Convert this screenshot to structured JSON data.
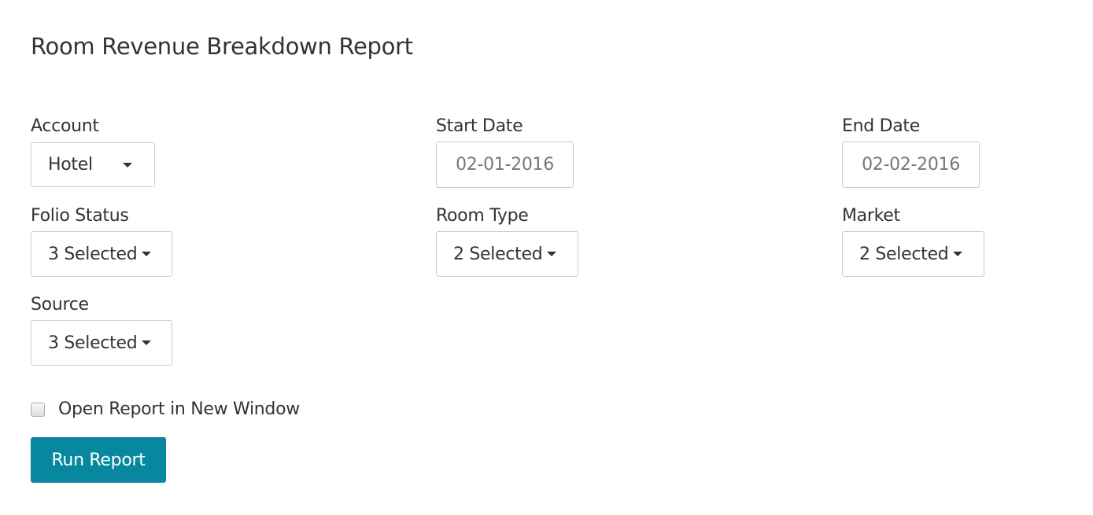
{
  "title": "Room Revenue Breakdown Report",
  "fields": {
    "account": {
      "label": "Account",
      "value": "Hotel"
    },
    "start_date": {
      "label": "Start Date",
      "value": "02-01-2016"
    },
    "end_date": {
      "label": "End Date",
      "value": "02-02-2016"
    },
    "folio_status": {
      "label": "Folio Status",
      "value": "3 Selected"
    },
    "room_type": {
      "label": "Room Type",
      "value": "2 Selected"
    },
    "market": {
      "label": "Market",
      "value": "2 Selected"
    },
    "source": {
      "label": "Source",
      "value": "3 Selected"
    }
  },
  "open_new_window": {
    "label": "Open Report in New Window",
    "checked": false
  },
  "run_button": "Run Report",
  "colors": {
    "button": "#08889f"
  }
}
